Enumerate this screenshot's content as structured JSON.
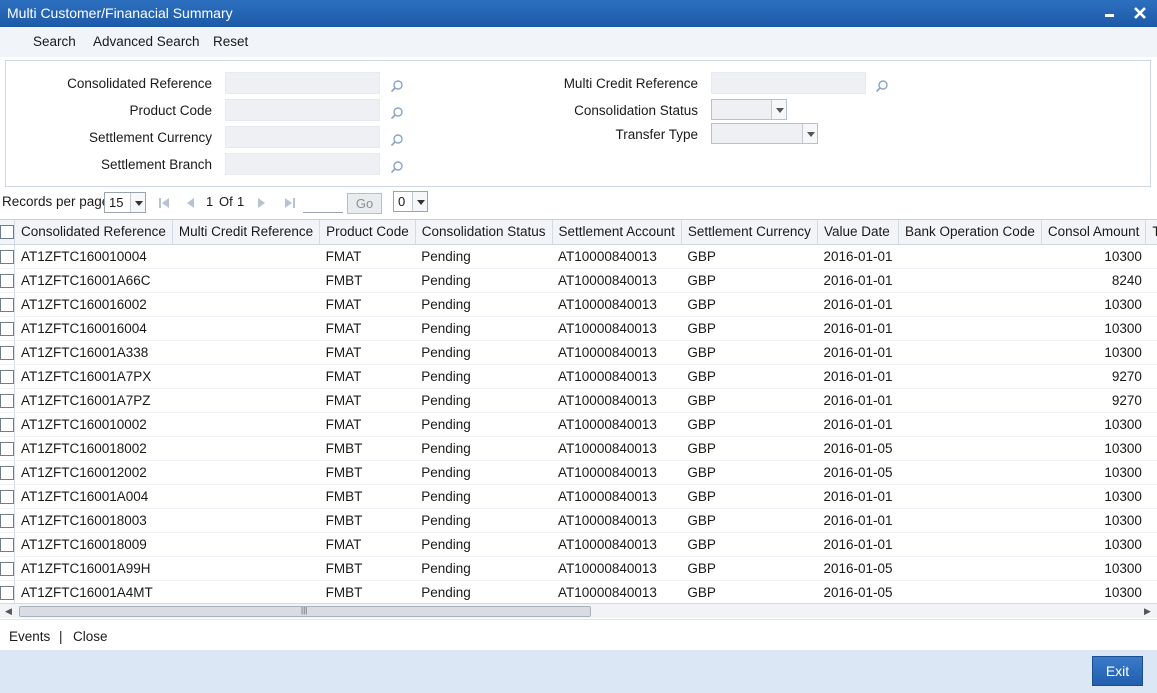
{
  "window": {
    "title": "Multi Customer/Finanacial Summary"
  },
  "menu": {
    "search": "Search",
    "advanced_search": "Advanced Search",
    "reset": "Reset"
  },
  "search_fields": {
    "consolidated_reference": "Consolidated Reference",
    "product_code": "Product Code",
    "settlement_currency": "Settlement Currency",
    "settlement_branch": "Settlement Branch",
    "multi_credit_reference": "Multi Credit Reference",
    "consolidation_status": "Consolidation Status",
    "transfer_type": "Transfer Type"
  },
  "pager": {
    "records_per_page_label": "Records per page",
    "records_per_page": "15",
    "current_page": "1",
    "of_label": "Of",
    "total_pages": "1",
    "go_label": "Go",
    "selected_count": "0"
  },
  "grid": {
    "columns": [
      "Consolidated Reference",
      "Multi Credit Reference",
      "Product Code",
      "Consolidation Status",
      "Settlement Account",
      "Settlement Currency",
      "Value Date",
      "Bank Operation Code",
      "Consol Amount",
      "T"
    ],
    "rows": [
      [
        "AT1ZFTC160010004",
        "",
        "FMAT",
        "Pending",
        "AT10000840013",
        "GBP",
        "2016-01-01",
        "",
        "10300"
      ],
      [
        "AT1ZFTC16001A66C",
        "",
        "FMBT",
        "Pending",
        "AT10000840013",
        "GBP",
        "2016-01-01",
        "",
        "8240"
      ],
      [
        "AT1ZFTC160016002",
        "",
        "FMAT",
        "Pending",
        "AT10000840013",
        "GBP",
        "2016-01-01",
        "",
        "10300"
      ],
      [
        "AT1ZFTC160016004",
        "",
        "FMAT",
        "Pending",
        "AT10000840013",
        "GBP",
        "2016-01-01",
        "",
        "10300"
      ],
      [
        "AT1ZFTC16001A338",
        "",
        "FMAT",
        "Pending",
        "AT10000840013",
        "GBP",
        "2016-01-01",
        "",
        "10300"
      ],
      [
        "AT1ZFTC16001A7PX",
        "",
        "FMAT",
        "Pending",
        "AT10000840013",
        "GBP",
        "2016-01-01",
        "",
        "9270"
      ],
      [
        "AT1ZFTC16001A7PZ",
        "",
        "FMAT",
        "Pending",
        "AT10000840013",
        "GBP",
        "2016-01-01",
        "",
        "9270"
      ],
      [
        "AT1ZFTC160010002",
        "",
        "FMAT",
        "Pending",
        "AT10000840013",
        "GBP",
        "2016-01-01",
        "",
        "10300"
      ],
      [
        "AT1ZFTC160018002",
        "",
        "FMBT",
        "Pending",
        "AT10000840013",
        "GBP",
        "2016-01-05",
        "",
        "10300"
      ],
      [
        "AT1ZFTC160012002",
        "",
        "FMBT",
        "Pending",
        "AT10000840013",
        "GBP",
        "2016-01-05",
        "",
        "10300"
      ],
      [
        "AT1ZFTC16001A004",
        "",
        "FMBT",
        "Pending",
        "AT10000840013",
        "GBP",
        "2016-01-01",
        "",
        "10300"
      ],
      [
        "AT1ZFTC160018003",
        "",
        "FMBT",
        "Pending",
        "AT10000840013",
        "GBP",
        "2016-01-01",
        "",
        "10300"
      ],
      [
        "AT1ZFTC160018009",
        "",
        "FMAT",
        "Pending",
        "AT10000840013",
        "GBP",
        "2016-01-01",
        "",
        "10300"
      ],
      [
        "AT1ZFTC16001A99H",
        "",
        "FMBT",
        "Pending",
        "AT10000840013",
        "GBP",
        "2016-01-05",
        "",
        "10300"
      ],
      [
        "AT1ZFTC16001A4MT",
        "",
        "FMBT",
        "Pending",
        "AT10000840013",
        "GBP",
        "2016-01-05",
        "",
        "10300"
      ]
    ]
  },
  "footer": {
    "events": "Events",
    "separator": "|",
    "close": "Close",
    "exit": "Exit"
  },
  "icons": {
    "lookup": "magnifier-icon",
    "minimize": "minimize-icon",
    "close": "close-icon"
  },
  "colors": {
    "title_bar": "#1c5aa8",
    "bottom_bar": "#dbe7f4",
    "exit_button": "#215fae"
  }
}
